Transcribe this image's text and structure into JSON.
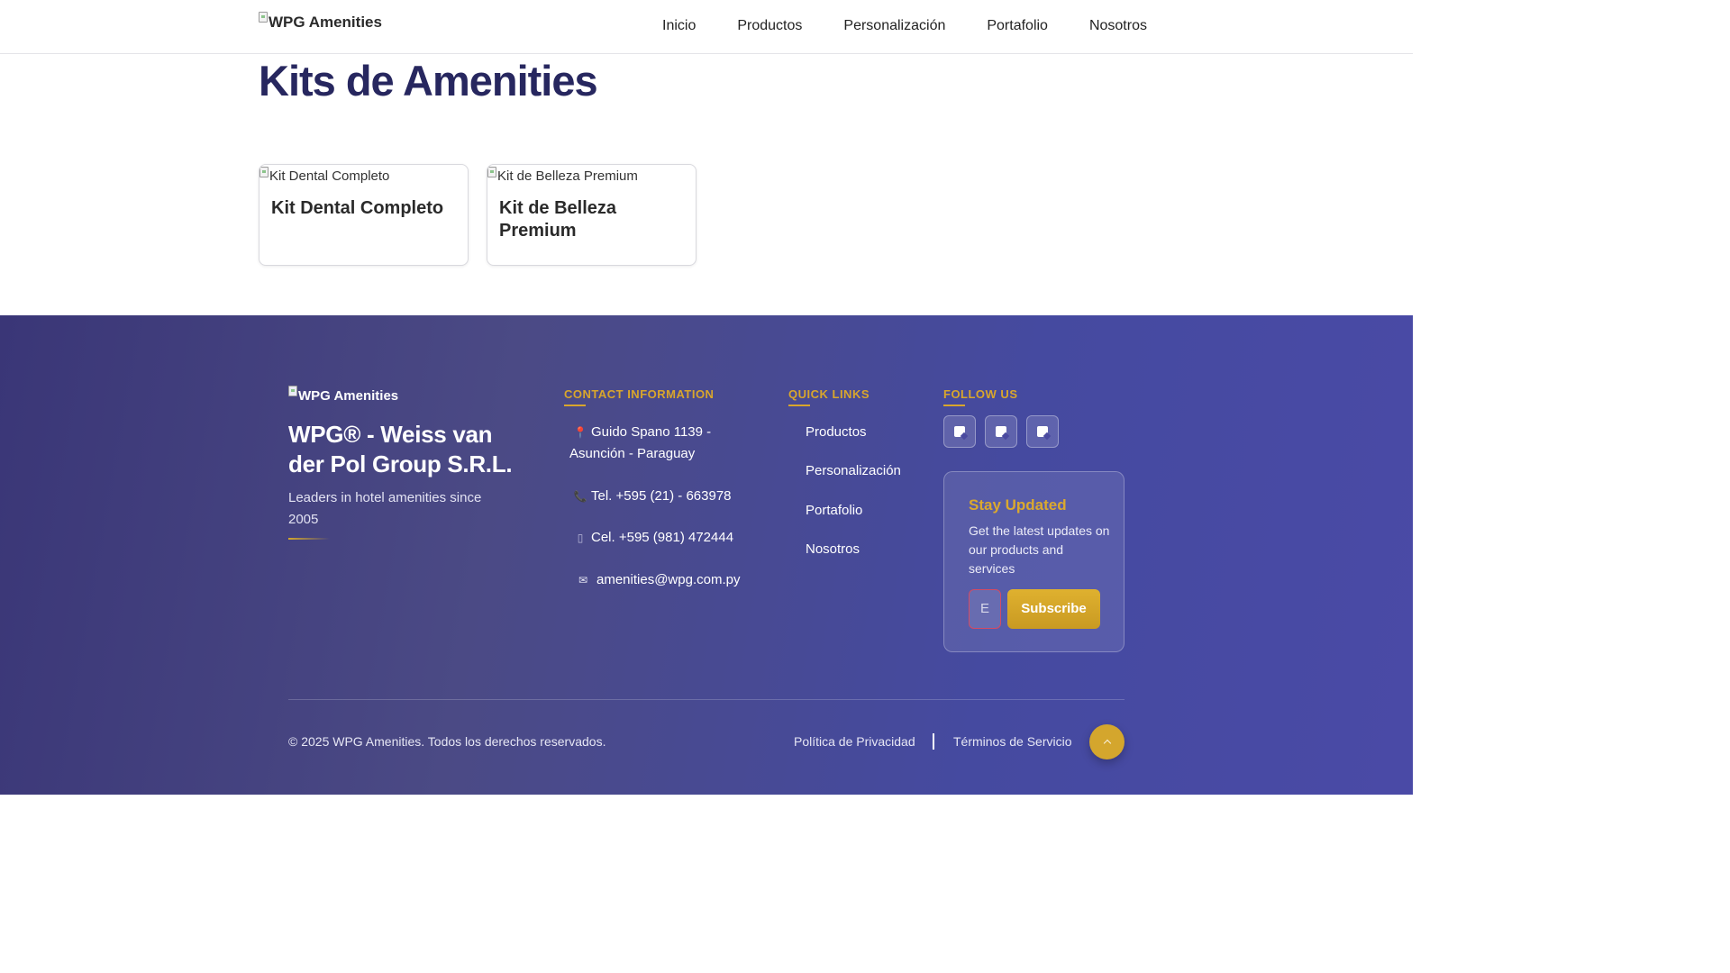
{
  "header": {
    "logo_alt": "WPG Amenities",
    "nav": [
      "Inicio",
      "Productos",
      "Personalización",
      "Portafolio",
      "Nosotros"
    ]
  },
  "main": {
    "title": "Kits de Amenities",
    "cards": [
      {
        "image_alt": "Kit Dental Completo",
        "title": "Kit Dental Completo"
      },
      {
        "image_alt": "Kit de Belleza Premium",
        "title": "Kit de Belleza Premium"
      }
    ]
  },
  "footer": {
    "logo_alt": "WPG Amenities",
    "company": "WPG® - Weiss van der Pol Group S.R.L.",
    "tagline": "Leaders in hotel amenities since 2005",
    "contact": {
      "heading": "CONTACT INFORMATION",
      "address": "Guido Spano 1139 - Asunción - Paraguay",
      "phone": "Tel. +595 (21) - 663978",
      "mobile": "Cel. +595 (981) 472444",
      "email": "amenities@wpg.com.py",
      "icons": [
        "pin-icon",
        "phone-icon",
        "mobile-icon",
        "mail-icon"
      ]
    },
    "quick_links": {
      "heading": "QUICK LINKS",
      "items": [
        "Productos",
        "Personalización",
        "Portafolio",
        "Nosotros"
      ]
    },
    "follow": {
      "heading": "FOLLOW US",
      "icons": [
        "social-icon-1",
        "social-icon-2",
        "social-icon-3"
      ]
    },
    "newsletter": {
      "title": "Stay Updated",
      "text": "Get the latest updates on our products and services",
      "input_value": "E",
      "button": "Subscribe"
    },
    "copyright": "© 2025 WPG Amenities. Todos los derechos reservados.",
    "privacy": "Política de Privacidad",
    "terms": "Términos de Servicio"
  },
  "colors": {
    "title": "#27275f",
    "footer_start": "#3a3677",
    "footer_end": "#4a4aa6",
    "accent_gold": "#d9a62c"
  }
}
